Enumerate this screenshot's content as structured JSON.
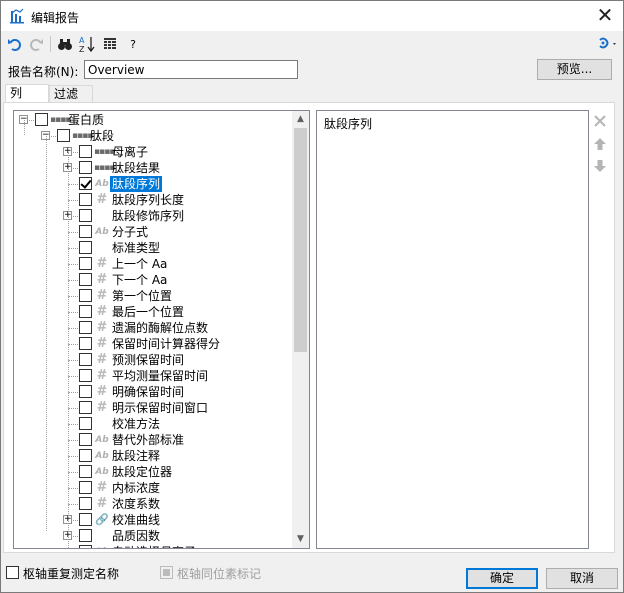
{
  "window": {
    "title": "编辑报告",
    "close_glyph": "✕"
  },
  "toolbar": {
    "undo_icon": "undo-icon",
    "redo_icon": "redo-icon",
    "find_icon": "binoculars-icon",
    "sort_icon": "sort-az-icon",
    "columns_icon": "grid-icon",
    "help_label": "?",
    "settings_icon": "settings-dropdown-icon"
  },
  "report_name": {
    "label": "报告名称(N):",
    "value": "Overview"
  },
  "preview_label": "预览...",
  "tabs": [
    "列",
    "过滤器"
  ],
  "tree": [
    {
      "label": "蛋白质",
      "icon": "table-icon",
      "level": 0,
      "expander": "-",
      "checked": false
    },
    {
      "label": "肽段",
      "icon": "table-icon",
      "level": 1,
      "expander": "-",
      "checked": false
    },
    {
      "label": "母离子",
      "icon": "table-icon",
      "level": 2,
      "expander": "+",
      "checked": false
    },
    {
      "label": "肽段结果",
      "icon": "table-icon",
      "level": 2,
      "expander": "+",
      "checked": false
    },
    {
      "label": "肽段序列",
      "icon": "text-icon",
      "level": 2,
      "expander": "",
      "checked": true,
      "selected": true
    },
    {
      "label": "肽段序列长度",
      "icon": "number-icon",
      "level": 2,
      "expander": "",
      "checked": false
    },
    {
      "label": "肽段修饰序列",
      "icon": "none",
      "level": 2,
      "expander": "+",
      "checked": false
    },
    {
      "label": "分子式",
      "icon": "text-icon",
      "level": 2,
      "expander": "",
      "checked": false
    },
    {
      "label": "标准类型",
      "icon": "none",
      "level": 2,
      "expander": "",
      "checked": false
    },
    {
      "label": "上一个 Aa",
      "icon": "number-icon",
      "level": 2,
      "expander": "",
      "checked": false
    },
    {
      "label": "下一个 Aa",
      "icon": "number-icon",
      "level": 2,
      "expander": "",
      "checked": false
    },
    {
      "label": "第一个位置",
      "icon": "number-icon",
      "level": 2,
      "expander": "",
      "checked": false
    },
    {
      "label": "最后一个位置",
      "icon": "number-icon",
      "level": 2,
      "expander": "",
      "checked": false
    },
    {
      "label": "遗漏的酶解位点数",
      "icon": "number-icon",
      "level": 2,
      "expander": "",
      "checked": false
    },
    {
      "label": "保留时间计算器得分",
      "icon": "number-icon",
      "level": 2,
      "expander": "",
      "checked": false
    },
    {
      "label": "预测保留时间",
      "icon": "number-icon",
      "level": 2,
      "expander": "",
      "checked": false
    },
    {
      "label": "平均测量保留时间",
      "icon": "number-icon",
      "level": 2,
      "expander": "",
      "checked": false
    },
    {
      "label": "明确保留时间",
      "icon": "number-icon",
      "level": 2,
      "expander": "",
      "checked": false
    },
    {
      "label": "明示保留时间窗口",
      "icon": "number-icon",
      "level": 2,
      "expander": "",
      "checked": false
    },
    {
      "label": "校准方法",
      "icon": "none",
      "level": 2,
      "expander": "",
      "checked": false
    },
    {
      "label": "替代外部标准",
      "icon": "text-icon",
      "level": 2,
      "expander": "",
      "checked": false
    },
    {
      "label": "肽段注释",
      "icon": "text-icon",
      "level": 2,
      "expander": "",
      "checked": false
    },
    {
      "label": "肽段定位器",
      "icon": "text-icon",
      "level": 2,
      "expander": "",
      "checked": false
    },
    {
      "label": "内标浓度",
      "icon": "number-icon",
      "level": 2,
      "expander": "",
      "checked": false
    },
    {
      "label": "浓度系数",
      "icon": "number-icon",
      "level": 2,
      "expander": "",
      "checked": false
    },
    {
      "label": "校准曲线",
      "icon": "link-icon",
      "level": 2,
      "expander": "+",
      "checked": false
    },
    {
      "label": "品质因数",
      "icon": "none",
      "level": 2,
      "expander": "+",
      "checked": false
    },
    {
      "label": "自动选择母离子",
      "icon": "text-icon",
      "level": 2,
      "expander": "",
      "checked": false
    }
  ],
  "selected_columns": [
    "肽段序列"
  ],
  "side_buttons": [
    "remove-icon",
    "move-up-icon",
    "move-down-icon"
  ],
  "footer": {
    "pivot_replicate_label": "枢轴重复测定名称",
    "pivot_isotope_label": "枢轴同位素标记",
    "ok_label": "确定",
    "cancel_label": "取消"
  },
  "colors": {
    "selection": "#0078d7",
    "accent_blue": "#1a6fc9"
  }
}
